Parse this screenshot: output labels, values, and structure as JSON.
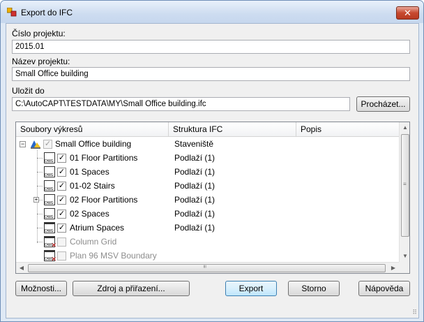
{
  "window": {
    "title": "Export do IFC",
    "close_glyph": "✕"
  },
  "form": {
    "project_number_label": "Číslo projektu:",
    "project_number_value": "2015.01",
    "project_name_label": "Název projektu:",
    "project_name_value": "Small Office building",
    "save_to_label": "Uložit do",
    "save_to_value": "C:\\AutoCAPT\\TESTDATA\\MY\\Small Office building.ifc",
    "browse_label": "Procházet..."
  },
  "tree": {
    "columns": [
      "Soubory výkresů",
      "Struktura IFC",
      "Popis"
    ],
    "rows": [
      {
        "label": "Small Office building",
        "ifc": "Staveniště",
        "checked": true,
        "enabled": false,
        "icon": "project-icon",
        "level": 0
      },
      {
        "label": "01 Floor Partitions",
        "ifc": "Podlaží (1)",
        "checked": true,
        "enabled": true,
        "icon": "dwg-icon",
        "level": 1
      },
      {
        "label": "01 Spaces",
        "ifc": "Podlaží (1)",
        "checked": true,
        "enabled": true,
        "icon": "dwg-icon",
        "level": 1
      },
      {
        "label": "01-02 Stairs",
        "ifc": "Podlaží (1)",
        "checked": true,
        "enabled": true,
        "icon": "dwg-icon",
        "level": 1
      },
      {
        "label": "02 Floor Partitions",
        "ifc": "Podlaží (1)",
        "checked": true,
        "enabled": true,
        "icon": "dwg-icon",
        "level": 1,
        "expandable": true
      },
      {
        "label": "02 Spaces",
        "ifc": "Podlaží (1)",
        "checked": true,
        "enabled": true,
        "icon": "dwg-icon",
        "level": 1
      },
      {
        "label": "Atrium Spaces",
        "ifc": "Podlaží (1)",
        "checked": true,
        "enabled": true,
        "icon": "dwg-open-icon",
        "level": 1
      },
      {
        "label": "Column Grid",
        "ifc": "",
        "checked": false,
        "enabled": false,
        "icon": "dwg-excluded-icon",
        "level": 1
      },
      {
        "label": "Plan 96 MSV Boundary",
        "ifc": "",
        "checked": false,
        "enabled": false,
        "icon": "dwg-excluded-icon",
        "level": 1
      }
    ]
  },
  "buttons": {
    "options": "Možnosti...",
    "source_assignment": "Zdroj a přiřazení...",
    "export": "Export",
    "cancel": "Storno",
    "help": "Nápověda"
  }
}
